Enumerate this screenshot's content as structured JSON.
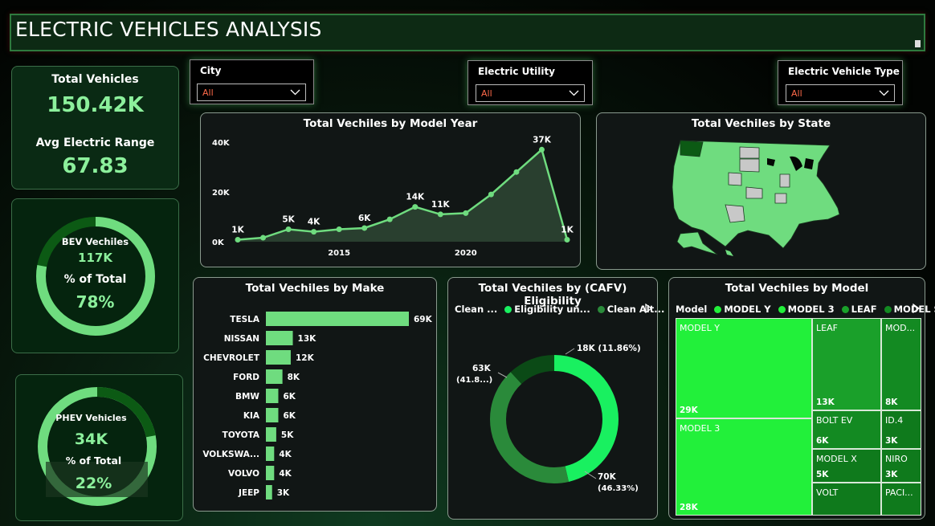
{
  "title": "ELECTRIC VEHICLES ANALYSIS",
  "kpi": {
    "total_label": "Total Vehicles",
    "total_value": "150.42K",
    "range_label": "Avg Electric Range",
    "range_value": "67.83"
  },
  "bev": {
    "label": "BEV Vechiles",
    "value": "117K",
    "pct_label": "% of Total",
    "pct": "78%",
    "fraction": 0.78
  },
  "phev": {
    "label": "PHEV Vehicles",
    "value": "34K",
    "pct_label": "% of Total",
    "pct": "22%",
    "fraction": 0.22
  },
  "slicers": [
    {
      "label": "City",
      "value": "All"
    },
    {
      "label": "Electric Utility",
      "value": "All"
    },
    {
      "label": "Electric Vehicle Type",
      "value": "All"
    }
  ],
  "titles": {
    "model_year": "Total Vechiles by Model Year",
    "state": "Total Vechiles by State",
    "make": "Total Vechiles by Make",
    "cafv": "Total Vechiles by (CAFV) Eligibility",
    "model": "Total Vechiles by Model"
  },
  "cafv_legend": [
    "Clean ...",
    "Eligibility un...",
    "Clean Alt..."
  ],
  "model_legend": {
    "title": "Model",
    "items": [
      "MODEL Y",
      "MODEL 3",
      "LEAF",
      "MODEL S"
    ]
  },
  "colors": {
    "accent": "#6fdc7f",
    "bright": "#22f03a",
    "dark": "#0c5a14",
    "title_bg": "#0d2a14"
  },
  "chart_data": [
    {
      "type": "area",
      "title": "Total Vechiles by Model Year",
      "x": [
        2011,
        2012,
        2013,
        2014,
        2015,
        2016,
        2017,
        2018,
        2019,
        2020,
        2021,
        2022,
        2023,
        2024
      ],
      "values": [
        800,
        1600,
        5000,
        4000,
        5000,
        5500,
        9000,
        14000,
        11000,
        11500,
        19000,
        28000,
        37000,
        800
      ],
      "data_labels": {
        "0": "1K",
        "2": "5K",
        "3": "4K",
        "5": "6K",
        "7": "14K",
        "8": "11K",
        "12": "37K",
        "13": "1K"
      },
      "x_ticks": [
        "2015",
        "2020"
      ],
      "y_ticks": [
        "0K",
        "20K",
        "40K"
      ],
      "ylim": [
        0,
        40000
      ],
      "grid": false
    },
    {
      "type": "bar",
      "title": "Total Vechiles by Make",
      "categories": [
        "TESLA",
        "NISSAN",
        "CHEVROLET",
        "FORD",
        "BMW",
        "KIA",
        "TOYOTA",
        "VOLKSWA...",
        "VOLVO",
        "JEEP"
      ],
      "values": [
        69,
        13,
        12,
        8,
        6,
        6,
        5,
        4,
        4,
        3
      ],
      "labels": [
        "69K",
        "13K",
        "12K",
        "8K",
        "6K",
        "6K",
        "5K",
        "4K",
        "4K",
        "3K"
      ]
    },
    {
      "type": "pie",
      "title": "Total Vechiles by (CAFV) Eligibility",
      "categories": [
        "Clean ...",
        "Eligibility un...",
        "Clean Alt..."
      ],
      "values": [
        70,
        63,
        18
      ],
      "labels": [
        "70K",
        "63K",
        "18K (11.86%)"
      ],
      "percent_labels": [
        "(46.33%)",
        "(41.8...)",
        ""
      ],
      "colors": [
        "#19f060",
        "#2a8a3a",
        "#0b4a16"
      ]
    },
    {
      "type": "heatmap",
      "title": "Total Vechiles by Model",
      "categories": [
        "MODEL Y",
        "MODEL 3",
        "LEAF",
        "MOD...",
        "BOLT EV",
        "ID.4",
        "MODEL X",
        "NIRO",
        "VOLT",
        "PACI..."
      ],
      "values": [
        29,
        28,
        13,
        8,
        6,
        3,
        5,
        3,
        null,
        null
      ],
      "labels": [
        "29K",
        "28K",
        "13K",
        "8K",
        "6K",
        "3K",
        "5K",
        "3K",
        "",
        ""
      ]
    }
  ]
}
